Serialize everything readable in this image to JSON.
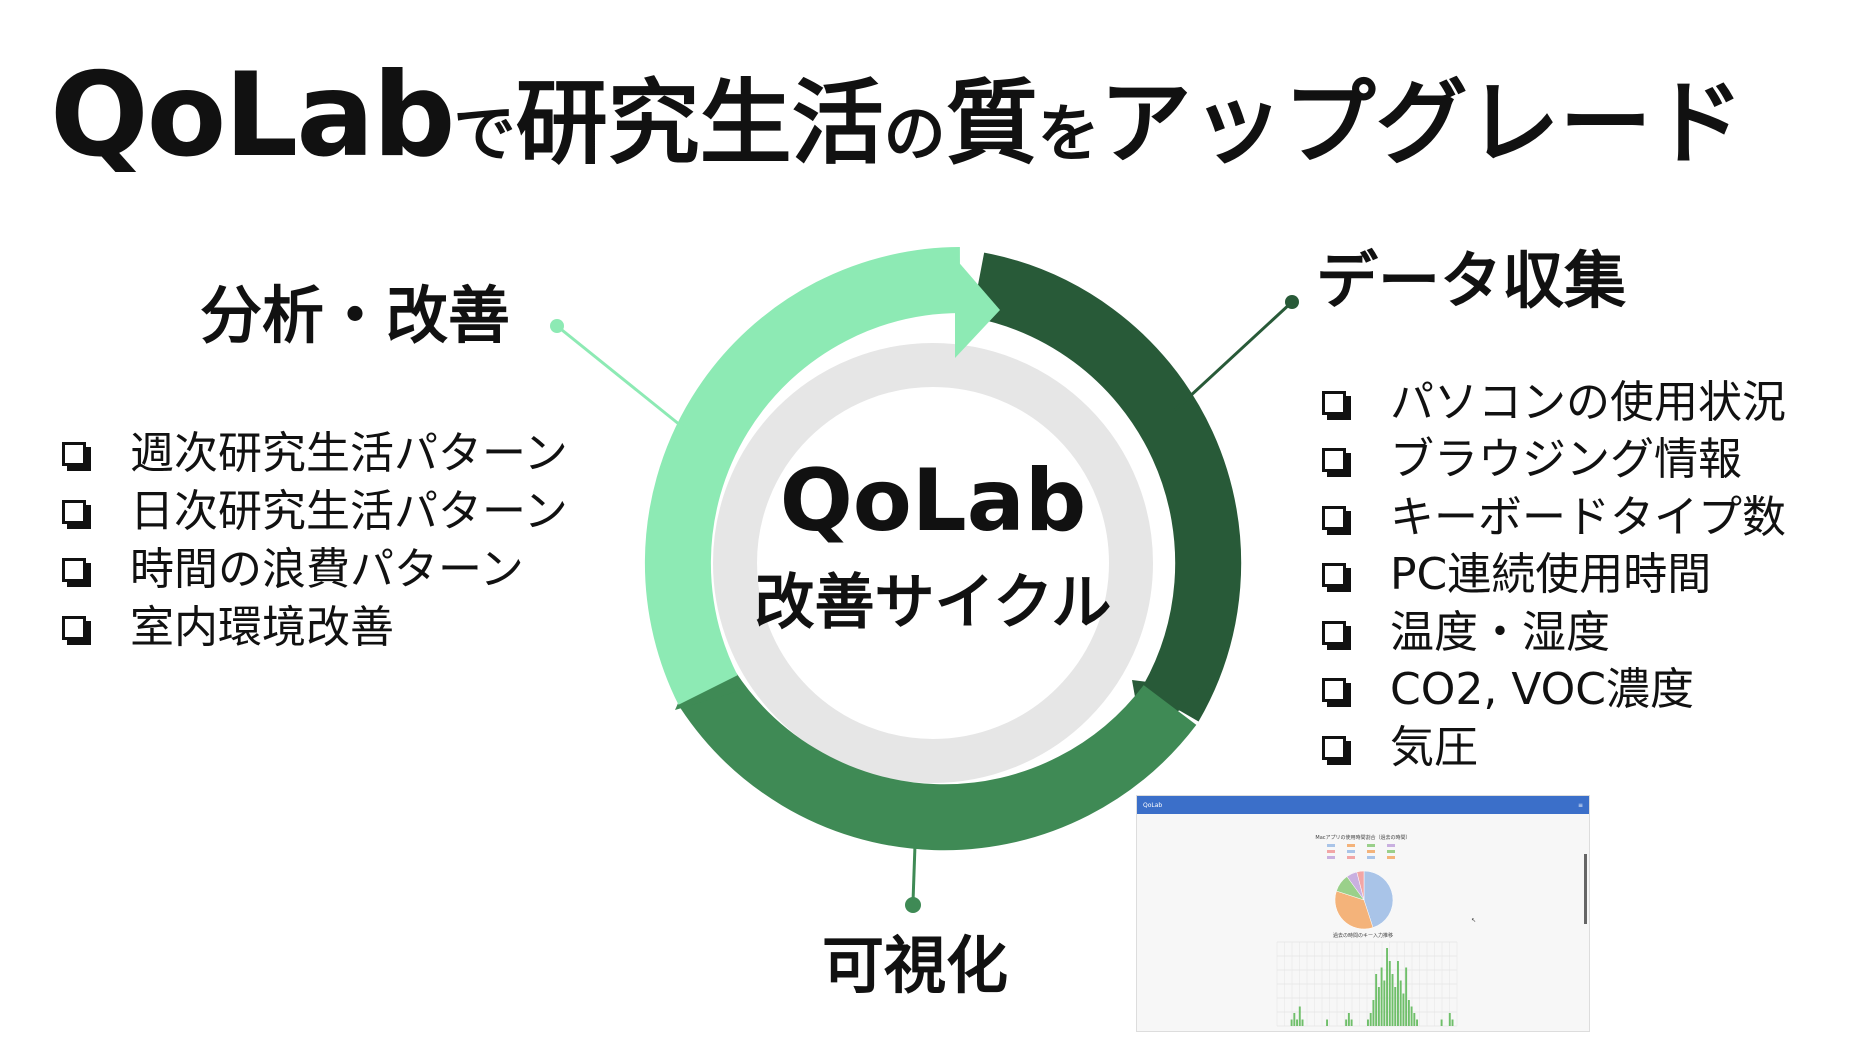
{
  "title": {
    "brand": "QoLab",
    "segments": [
      {
        "text": "で",
        "size": "small"
      },
      {
        "text": "研究生活",
        "size": "mid"
      },
      {
        "text": "の",
        "size": "small"
      },
      {
        "text": "質",
        "size": "mid"
      },
      {
        "text": "を",
        "size": "small"
      },
      {
        "text": "アップグレード",
        "size": "mid"
      }
    ]
  },
  "center": {
    "main": "QoLab",
    "sub": "改善サイクル"
  },
  "sections": {
    "analysis": {
      "label": "分析・改善",
      "items": [
        "週次研究生活パターン",
        "日次研究生活パターン",
        "時間の浪費パターン",
        "室内環境改善"
      ]
    },
    "collection": {
      "label": "データ収集",
      "items": [
        "パソコンの使用状況",
        "ブラウジング情報",
        "キーボードタイプ数",
        "PC連続使用時間",
        "温度・湿度",
        "CO2, VOC濃度",
        "気圧"
      ]
    },
    "visualization": {
      "label": "可視化"
    }
  },
  "colors": {
    "light_green": "#8deab4",
    "dark_green": "#285a38",
    "mid_green": "#3f8a55",
    "inner_ring": "#e6e6e6",
    "text": "#111111"
  },
  "screenshot": {
    "app_name": "QoLab",
    "pie_title": "Macアプリの使用時間割合（過去の時間）",
    "bar_title": "過去の時間のキー入力推移",
    "pie_slices": [
      {
        "value": 45,
        "color": "#a9c4e8"
      },
      {
        "value": 35,
        "color": "#f4b37a"
      },
      {
        "value": 10,
        "color": "#9ad08a"
      },
      {
        "value": 6,
        "color": "#c9b0e0"
      },
      {
        "value": 4,
        "color": "#f2a6a6"
      }
    ],
    "bars": [
      0,
      0,
      0,
      0,
      0,
      1,
      2,
      1,
      3,
      1,
      0,
      0,
      0,
      0,
      0,
      0,
      0,
      0,
      1,
      0,
      0,
      0,
      0,
      0,
      0,
      1,
      2,
      1,
      0,
      0,
      0,
      0,
      0,
      1,
      2,
      4,
      8,
      6,
      9,
      7,
      12,
      10,
      8,
      6,
      10,
      7,
      5,
      9,
      4,
      3,
      2,
      1,
      0,
      0,
      0,
      0,
      0,
      0,
      0,
      0,
      1,
      0,
      0,
      2,
      1,
      0
    ]
  }
}
